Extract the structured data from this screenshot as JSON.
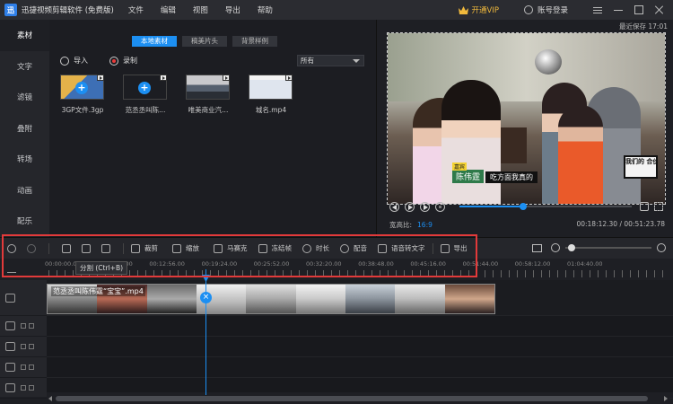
{
  "app": {
    "title": "迅捷视频剪辑软件 (免费版)",
    "logo_text": "迅",
    "menu": [
      "文件",
      "编辑",
      "视图",
      "导出",
      "帮助"
    ],
    "vip_label": "开通VIP",
    "login_label": "账号登录",
    "autosave": "最近保存 17:01"
  },
  "leftnav": [
    "素材",
    "文字",
    "滤镜",
    "叠附",
    "转场",
    "动画",
    "配乐"
  ],
  "media": {
    "tabs": [
      "本地素材",
      "稿美片头",
      "背景样例"
    ],
    "import_label": "导入",
    "record_label": "录制",
    "filter_value": "所有",
    "items": [
      {
        "label": "3GP文件.3gp"
      },
      {
        "label": "范丞丞叫陈..."
      },
      {
        "label": "唯美商业汽..."
      },
      {
        "label": "城名.mp4"
      }
    ]
  },
  "preview": {
    "caption_tag": "嘉宾",
    "caption_name": "陈伟霆",
    "caption_text": "吃方面我真的",
    "show_logo": "我们的 合伙人",
    "progress": 0.37,
    "ratio_label": "宽高比:",
    "ratio_value": "16:9",
    "timecode": "00:18:12.30 / 00:51:23.78"
  },
  "toolbar": {
    "crop": "裁剪",
    "zoom": "缩放",
    "mosaic": "马赛克",
    "freeze": "冻结帧",
    "duration": "时长",
    "dub": "配音",
    "speech_to_text": "语音转文字",
    "export": "导出",
    "tooltip": "分割 (Ctrl+B)"
  },
  "ruler": {
    "labels": [
      "00:00:00.00",
      "00:06:28.00",
      "00:12:56.00",
      "00:19:24.00",
      "00:25:52.00",
      "00:32:20.00",
      "00:38:48.00",
      "00:45:16.00",
      "00:51:44.00",
      "00:58:12.00",
      "01:04:40.00"
    ]
  },
  "timeline": {
    "clip_label": "范丞丞叫陈伟霆“宝宝”.mp4"
  }
}
